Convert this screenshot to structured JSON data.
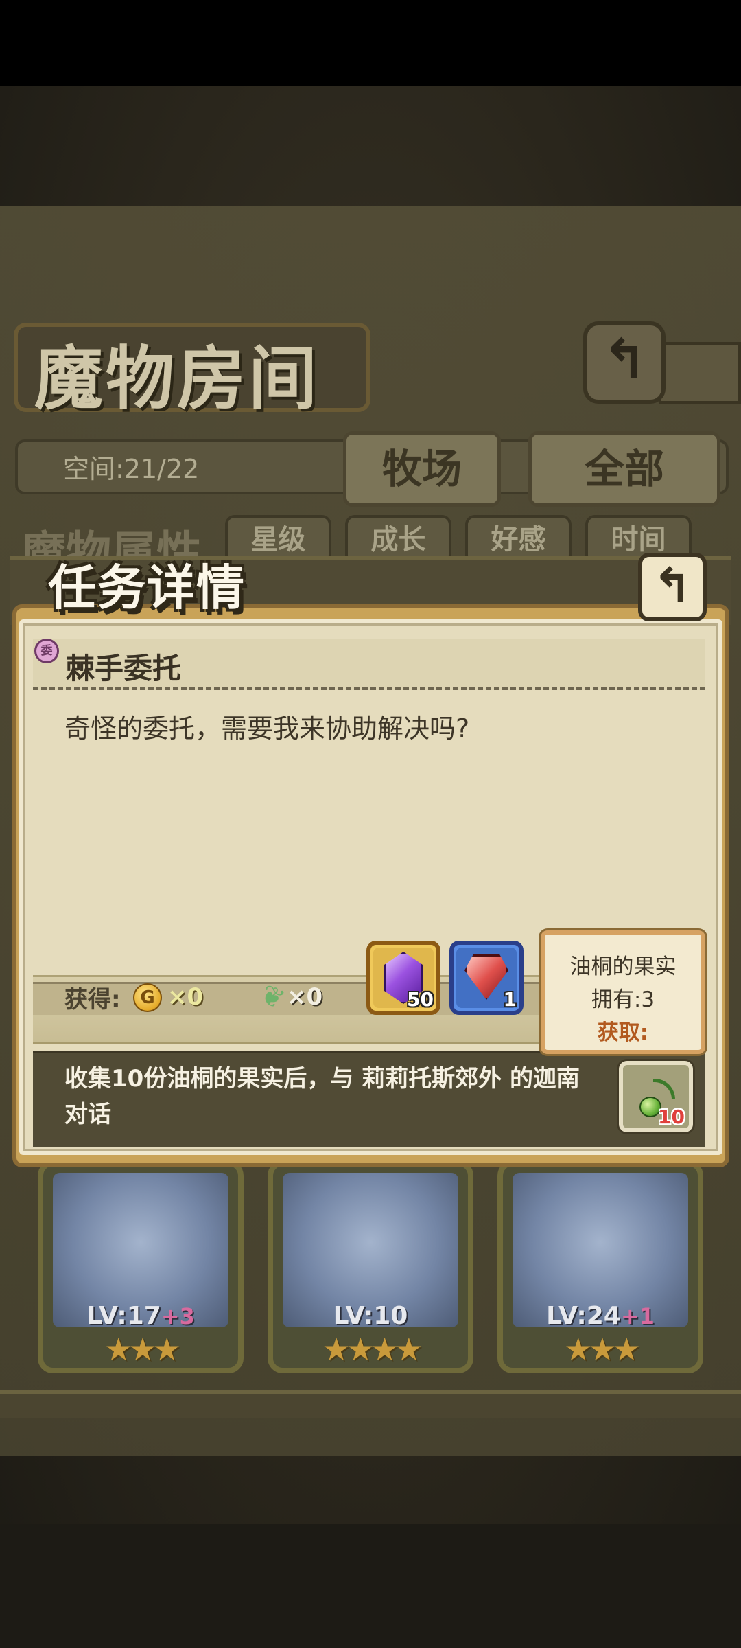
{
  "room": {
    "title": "魔物房间",
    "back_icon": "return-arrow-icon",
    "space_label": "空间:21/22",
    "tabs": [
      "牧场",
      "全部"
    ],
    "section_title": "魔物属性",
    "filters": [
      "星级",
      "成长",
      "好感",
      "时间"
    ]
  },
  "monsters": [
    {
      "level": "LV:17",
      "bonus": "+3",
      "stars": "★★★"
    },
    {
      "level": "LV:10",
      "bonus": "",
      "stars": "★★★★"
    },
    {
      "level": "LV:24",
      "bonus": "+1",
      "stars": "★★★"
    }
  ],
  "dialog": {
    "title": "任务详情",
    "close_icon": "return-arrow-icon",
    "quest_tag": "委",
    "quest_name": "棘手委托",
    "description": "奇怪的委托，需要我来协助解决吗?",
    "reward_label": "获得:",
    "coin_symbol": "G",
    "coin_value": "×0",
    "feather_value": "×0",
    "reward_items": [
      {
        "icon": "purple-gem-icon",
        "count": "50"
      },
      {
        "icon": "red-gem-icon",
        "count": "1"
      }
    ],
    "objective": "收集10份油桐的果实后，与 莉莉托斯郊外 的迦南对话",
    "objective_item": {
      "icon": "tung-fruit-icon",
      "count": "10"
    },
    "tooltip": {
      "name": "油桐的果实",
      "owned": "拥有:3",
      "obtain": "获取:"
    }
  },
  "colors": {
    "panel": "#e5dcbd",
    "frame": "#c9a358",
    "accent": "#b25a1f"
  }
}
